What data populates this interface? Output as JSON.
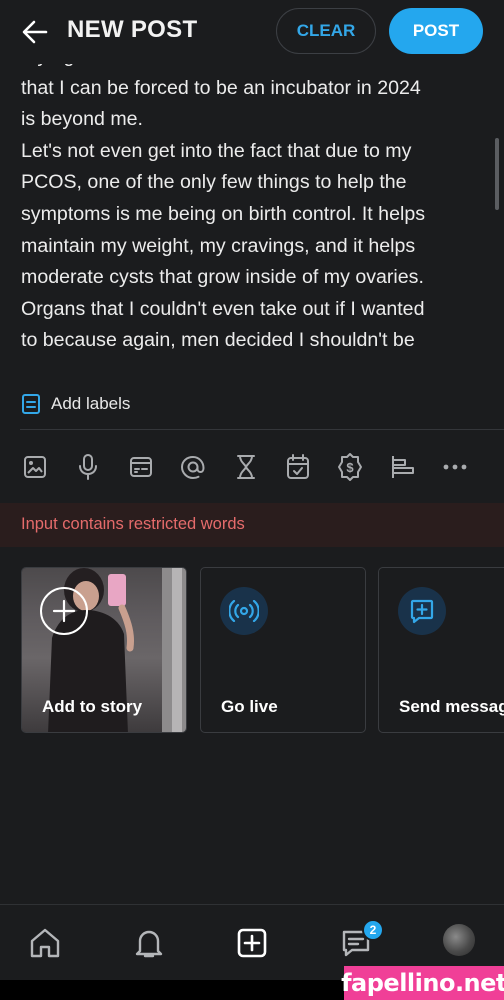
{
  "header": {
    "title": "NEW POST",
    "clear_label": "CLEAR",
    "post_label": "POST"
  },
  "editor": {
    "text": "my rights as a human to decide that. The fact\nthat I can be forced to be an incubator in 2024\nis beyond me.\nLet's not even get into the fact that due to my\nPCOS, one of the only few things to help the\nsymptoms is me being on birth control. It helps\nmaintain my weight, my cravings, and it helps\nmoderate cysts that grow inside of my ovaries.\nOrgans that I couldn't even take out if I wanted\nto because again, men decided I shouldn't be"
  },
  "labels": {
    "add_label": "Add labels"
  },
  "toolbar": {
    "icons": [
      "image-icon",
      "microphone-icon",
      "gif-icon",
      "mention-icon",
      "hourglass-icon",
      "poll-calendar-icon",
      "paid-badge-icon",
      "bar-chart-icon",
      "more-icon"
    ]
  },
  "warning": {
    "text": "Input contains restricted words"
  },
  "story_cards": {
    "add_story": "Add to story",
    "go_live": "Go live",
    "send_message": "Send message"
  },
  "bottom_nav": {
    "messages_badge": "2"
  },
  "watermark": {
    "text": "fapellino.net"
  },
  "colors": {
    "accent": "#24a7ee",
    "background": "#1b1c1e",
    "warning_text": "#e56b6b",
    "warning_bg": "#2a1d1d"
  }
}
